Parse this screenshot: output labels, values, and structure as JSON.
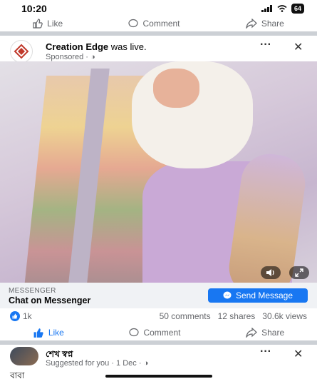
{
  "status_bar": {
    "time": "10:20",
    "battery": "64"
  },
  "top_actions": {
    "like": "Like",
    "comment": "Comment",
    "share": "Share"
  },
  "post": {
    "page_name": "Creation Edge",
    "activity": "was live.",
    "sponsored": "Sponsored",
    "cta_subtitle": "MESSENGER",
    "cta_title": "Chat on Messenger",
    "cta_button": "Send Message",
    "reactions": "1k",
    "comments": "50 comments",
    "shares": "12 shares",
    "views": "30.6k views",
    "actions": {
      "like": "Like",
      "comment": "Comment",
      "share": "Share"
    }
  },
  "suggested": {
    "user_name": "শেখ স্বপ্ন",
    "meta": "Suggested for you · 1 Dec ·",
    "text": "বাবা"
  },
  "colors": {
    "accent": "#1877f2",
    "muted": "#65676b",
    "divider": "#ccd0d5"
  }
}
